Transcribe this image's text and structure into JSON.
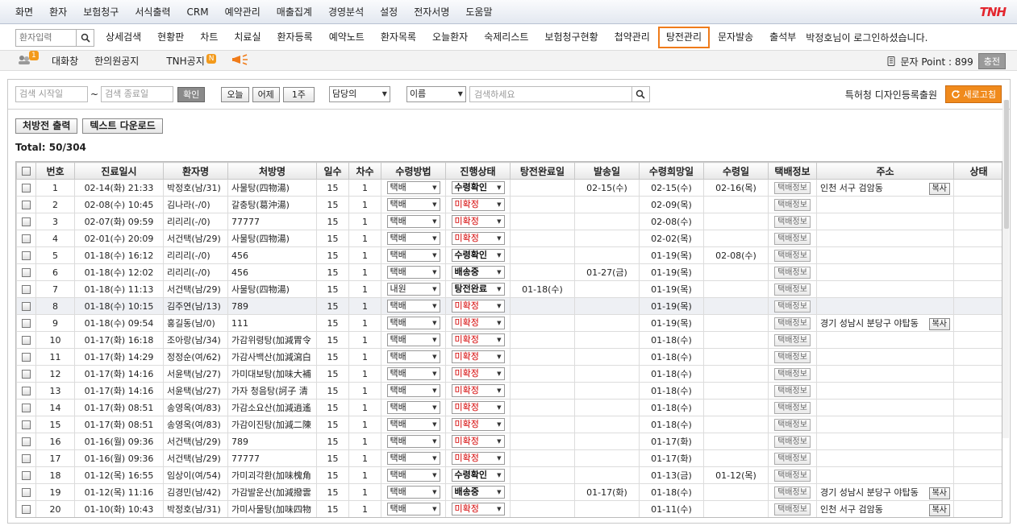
{
  "menu": [
    "화면",
    "환자",
    "보험청구",
    "서식출력",
    "CRM",
    "예약관리",
    "매출집계",
    "경영분석",
    "설정",
    "전자서명",
    "도움말"
  ],
  "brand": "TNH",
  "nav": {
    "search_placeholder": "환자입력",
    "items": [
      "상세검색",
      "현황판",
      "차트",
      "치료실",
      "환자등록",
      "예약노트",
      "환자목록",
      "오늘환자",
      "숙제리스트",
      "보험청구현황",
      "첩약관리",
      "탕전관리",
      "문자발송",
      "출석부"
    ],
    "active": "탕전관리",
    "welcome": "박정호님이 로그인하셨습니다."
  },
  "sub": {
    "chat": "대화창",
    "notice": "한의원공지",
    "tnh_notice": "TNH공지",
    "chat_badge": "1",
    "tnh_badge": "N",
    "sms_points": "문자 Point : 899",
    "charge": "충전"
  },
  "filters": {
    "start_placeholder": "검색 시작일",
    "end_placeholder": "검색 종료일",
    "tilde": "~",
    "confirm": "확인",
    "today": "오늘",
    "yesterday": "어제",
    "week": "1주",
    "doctor": "담당의",
    "name": "이름",
    "keyword_placeholder": "검색하세요",
    "design": "특허청 디자인등록출원",
    "refresh": "새로고침"
  },
  "actions": {
    "print": "처방전 출력",
    "download": "텍스트 다운로드"
  },
  "total": "Total: 50/304",
  "columns": [
    "번호",
    "진료일시",
    "환자명",
    "처방명",
    "일수",
    "차수",
    "수령방법",
    "진행상태",
    "탕전완료일",
    "발송일",
    "수령희망일",
    "수령일",
    "택배정보",
    "주소",
    "상태"
  ],
  "delivery_info": "택배정보",
  "copy": "복사",
  "rows": [
    [
      "1",
      "02-14(화) 21:33",
      "박정호(남/31)",
      "사물탕(四物湯)",
      "15",
      "1",
      "택배",
      "수령확인",
      "",
      "02-15(수)",
      "02-15(수)",
      "02-16(목)",
      "인천 서구 검암동"
    ],
    [
      "2",
      "02-08(수) 10:45",
      "김나라(-/0)",
      "갈충탕(葛沖湯)",
      "15",
      "1",
      "택배",
      "미확정",
      "",
      "",
      "02-09(목)",
      "",
      ""
    ],
    [
      "3",
      "02-07(화) 09:59",
      "리리리(-/0)",
      "77777",
      "15",
      "1",
      "택배",
      "미확정",
      "",
      "",
      "02-08(수)",
      "",
      ""
    ],
    [
      "4",
      "02-01(수) 20:09",
      "서건택(남/29)",
      "사물탕(四物湯)",
      "15",
      "1",
      "택배",
      "미확정",
      "",
      "",
      "02-02(목)",
      "",
      ""
    ],
    [
      "5",
      "01-18(수) 16:12",
      "리리리(-/0)",
      "456",
      "15",
      "1",
      "택배",
      "수령확인",
      "",
      "",
      "01-19(목)",
      "02-08(수)",
      ""
    ],
    [
      "6",
      "01-18(수) 12:02",
      "리리리(-/0)",
      "456",
      "15",
      "1",
      "택배",
      "배송중",
      "",
      "01-27(금)",
      "01-19(목)",
      "",
      ""
    ],
    [
      "7",
      "01-18(수) 11:13",
      "서건택(남/29)",
      "사물탕(四物湯)",
      "15",
      "1",
      "내원",
      "탕전완료",
      "01-18(수)",
      "",
      "01-19(목)",
      "",
      ""
    ],
    [
      "8",
      "01-18(수) 10:15",
      "김주연(남/13)",
      "789",
      "15",
      "1",
      "택배",
      "미확정",
      "",
      "",
      "01-19(목)",
      "",
      ""
    ],
    [
      "9",
      "01-18(수) 09:54",
      "홍길동(남/0)",
      "111",
      "15",
      "1",
      "택배",
      "미확정",
      "",
      "",
      "01-19(목)",
      "",
      "경기 성남시 분당구 야탑동"
    ],
    [
      "10",
      "01-17(화) 16:18",
      "조아랑(남/34)",
      "가감위령탕(加減胃令",
      "15",
      "1",
      "택배",
      "미확정",
      "",
      "",
      "01-18(수)",
      "",
      ""
    ],
    [
      "11",
      "01-17(화) 14:29",
      "정정순(여/62)",
      "가감사백산(加減瀉白",
      "15",
      "1",
      "택배",
      "미확정",
      "",
      "",
      "01-18(수)",
      "",
      ""
    ],
    [
      "12",
      "01-17(화) 14:16",
      "서윤택(남/27)",
      "가미대보탕(加味大補",
      "15",
      "1",
      "택배",
      "미확정",
      "",
      "",
      "01-18(수)",
      "",
      ""
    ],
    [
      "13",
      "01-17(화) 14:16",
      "서윤택(남/27)",
      "가자 청음탕(訶子 清",
      "15",
      "1",
      "택배",
      "미확정",
      "",
      "",
      "01-18(수)",
      "",
      ""
    ],
    [
      "14",
      "01-17(화) 08:51",
      "송영옥(여/83)",
      "가감소요산(加減逍遙",
      "15",
      "1",
      "택배",
      "미확정",
      "",
      "",
      "01-18(수)",
      "",
      ""
    ],
    [
      "15",
      "01-17(화) 08:51",
      "송영옥(여/83)",
      "가감이진탕(加減二陳",
      "15",
      "1",
      "택배",
      "미확정",
      "",
      "",
      "01-18(수)",
      "",
      ""
    ],
    [
      "16",
      "01-16(월) 09:36",
      "서건택(남/29)",
      "789",
      "15",
      "1",
      "택배",
      "미확정",
      "",
      "",
      "01-17(화)",
      "",
      ""
    ],
    [
      "17",
      "01-16(월) 09:36",
      "서건택(남/29)",
      "77777",
      "15",
      "1",
      "택배",
      "미확정",
      "",
      "",
      "01-17(화)",
      "",
      ""
    ],
    [
      "18",
      "01-12(목) 16:55",
      "임상이(여/54)",
      "가미괴각환(加味槐角",
      "15",
      "1",
      "택배",
      "수령확인",
      "",
      "",
      "01-13(금)",
      "01-12(목)",
      ""
    ],
    [
      "19",
      "01-12(목) 11:16",
      "김경민(남/42)",
      "가감발운산(加減撥雲",
      "15",
      "1",
      "택배",
      "배송중",
      "",
      "01-17(화)",
      "01-18(수)",
      "",
      "경기 성남시 분당구 야탑동"
    ],
    [
      "20",
      "01-10(화) 10:43",
      "박정호(남/31)",
      "가미사물탕(加味四物",
      "15",
      "1",
      "택배",
      "미확정",
      "",
      "",
      "01-11(수)",
      "",
      "인천 서구 검암동"
    ]
  ],
  "colors": {
    "accent": "#ef7b1a",
    "brand": "#e3262e",
    "status_red": "#d40000"
  }
}
